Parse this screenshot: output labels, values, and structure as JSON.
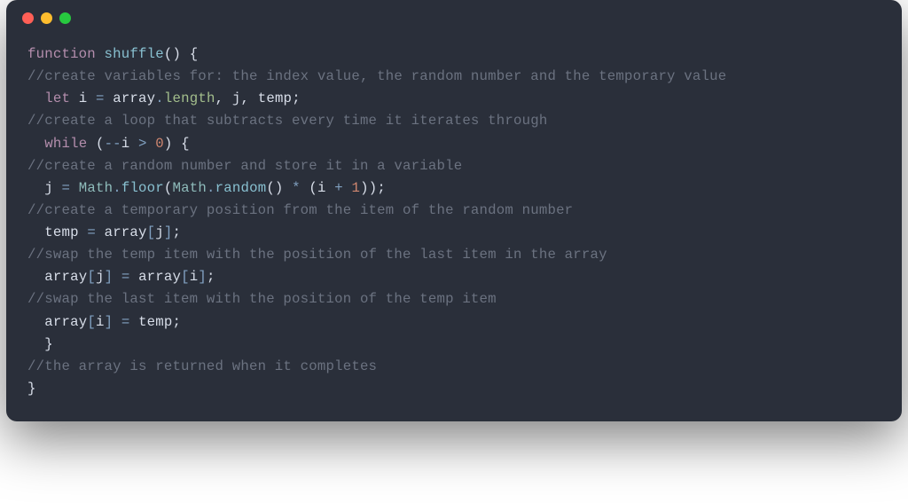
{
  "window": {
    "lines": [
      {
        "type": "code",
        "indent": 0,
        "tokens": [
          {
            "t": "keyword",
            "v": "function"
          },
          {
            "t": "space",
            "v": " "
          },
          {
            "t": "funcname",
            "v": "shuffle"
          },
          {
            "t": "paren",
            "v": "()"
          },
          {
            "t": "space",
            "v": " "
          },
          {
            "t": "brace",
            "v": "{"
          }
        ]
      },
      {
        "type": "comment",
        "indent": 0,
        "text": "//create variables for: the index value, the random number and the temporary value"
      },
      {
        "type": "code",
        "indent": 1,
        "tokens": [
          {
            "t": "keyword",
            "v": "let"
          },
          {
            "t": "space",
            "v": " "
          },
          {
            "t": "ident",
            "v": "i"
          },
          {
            "t": "space",
            "v": " "
          },
          {
            "t": "operator",
            "v": "="
          },
          {
            "t": "space",
            "v": " "
          },
          {
            "t": "ident",
            "v": "array"
          },
          {
            "t": "operator",
            "v": "."
          },
          {
            "t": "prop",
            "v": "length"
          },
          {
            "t": "comma",
            "v": ","
          },
          {
            "t": "space",
            "v": " "
          },
          {
            "t": "ident",
            "v": "j"
          },
          {
            "t": "comma",
            "v": ","
          },
          {
            "t": "space",
            "v": " "
          },
          {
            "t": "ident",
            "v": "temp"
          },
          {
            "t": "semicolon",
            "v": ";"
          }
        ]
      },
      {
        "type": "comment",
        "indent": 0,
        "text": "//create a loop that subtracts every time it iterates through"
      },
      {
        "type": "code",
        "indent": 1,
        "tokens": [
          {
            "t": "keyword",
            "v": "while"
          },
          {
            "t": "space",
            "v": " "
          },
          {
            "t": "paren",
            "v": "("
          },
          {
            "t": "operator",
            "v": "--"
          },
          {
            "t": "ident",
            "v": "i"
          },
          {
            "t": "space",
            "v": " "
          },
          {
            "t": "operator",
            "v": ">"
          },
          {
            "t": "space",
            "v": " "
          },
          {
            "t": "number",
            "v": "0"
          },
          {
            "t": "paren",
            "v": ")"
          },
          {
            "t": "space",
            "v": " "
          },
          {
            "t": "brace",
            "v": "{"
          }
        ]
      },
      {
        "type": "comment",
        "indent": 0,
        "text": "//create a random number and store it in a variable"
      },
      {
        "type": "code",
        "indent": 1,
        "tokens": [
          {
            "t": "ident",
            "v": "j"
          },
          {
            "t": "space",
            "v": " "
          },
          {
            "t": "operator",
            "v": "="
          },
          {
            "t": "space",
            "v": " "
          },
          {
            "t": "object",
            "v": "Math"
          },
          {
            "t": "operator",
            "v": "."
          },
          {
            "t": "method",
            "v": "floor"
          },
          {
            "t": "paren",
            "v": "("
          },
          {
            "t": "object",
            "v": "Math"
          },
          {
            "t": "operator",
            "v": "."
          },
          {
            "t": "method",
            "v": "random"
          },
          {
            "t": "paren",
            "v": "()"
          },
          {
            "t": "space",
            "v": " "
          },
          {
            "t": "operator",
            "v": "*"
          },
          {
            "t": "space",
            "v": " "
          },
          {
            "t": "paren",
            "v": "("
          },
          {
            "t": "ident",
            "v": "i"
          },
          {
            "t": "space",
            "v": " "
          },
          {
            "t": "operator",
            "v": "+"
          },
          {
            "t": "space",
            "v": " "
          },
          {
            "t": "number",
            "v": "1"
          },
          {
            "t": "paren",
            "v": "))"
          },
          {
            "t": "semicolon",
            "v": ";"
          }
        ]
      },
      {
        "type": "comment",
        "indent": 0,
        "text": "//create a temporary position from the item of the random number"
      },
      {
        "type": "code",
        "indent": 1,
        "tokens": [
          {
            "t": "ident",
            "v": "temp"
          },
          {
            "t": "space",
            "v": " "
          },
          {
            "t": "operator",
            "v": "="
          },
          {
            "t": "space",
            "v": " "
          },
          {
            "t": "ident",
            "v": "array"
          },
          {
            "t": "bracket",
            "v": "["
          },
          {
            "t": "ident",
            "v": "j"
          },
          {
            "t": "bracket",
            "v": "]"
          },
          {
            "t": "semicolon",
            "v": ";"
          }
        ]
      },
      {
        "type": "comment",
        "indent": 0,
        "text": "//swap the temp item with the position of the last item in the array"
      },
      {
        "type": "code",
        "indent": 1,
        "tokens": [
          {
            "t": "ident",
            "v": "array"
          },
          {
            "t": "bracket",
            "v": "["
          },
          {
            "t": "ident",
            "v": "j"
          },
          {
            "t": "bracket",
            "v": "]"
          },
          {
            "t": "space",
            "v": " "
          },
          {
            "t": "operator",
            "v": "="
          },
          {
            "t": "space",
            "v": " "
          },
          {
            "t": "ident",
            "v": "array"
          },
          {
            "t": "bracket",
            "v": "["
          },
          {
            "t": "ident",
            "v": "i"
          },
          {
            "t": "bracket",
            "v": "]"
          },
          {
            "t": "semicolon",
            "v": ";"
          }
        ]
      },
      {
        "type": "comment",
        "indent": 0,
        "text": "//swap the last item with the position of the temp item"
      },
      {
        "type": "code",
        "indent": 1,
        "tokens": [
          {
            "t": "ident",
            "v": "array"
          },
          {
            "t": "bracket",
            "v": "["
          },
          {
            "t": "ident",
            "v": "i"
          },
          {
            "t": "bracket",
            "v": "]"
          },
          {
            "t": "space",
            "v": " "
          },
          {
            "t": "operator",
            "v": "="
          },
          {
            "t": "space",
            "v": " "
          },
          {
            "t": "ident",
            "v": "temp"
          },
          {
            "t": "semicolon",
            "v": ";"
          }
        ]
      },
      {
        "type": "code",
        "indent": 1,
        "tokens": [
          {
            "t": "brace",
            "v": "}"
          }
        ]
      },
      {
        "type": "comment",
        "indent": 0,
        "text": "//the array is returned when it completes"
      },
      {
        "type": "code",
        "indent": 0,
        "tokens": [
          {
            "t": "brace",
            "v": "}"
          }
        ]
      }
    ]
  }
}
